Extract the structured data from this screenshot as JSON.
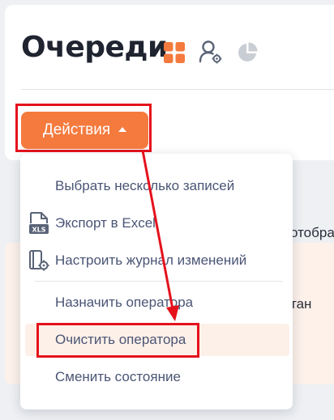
{
  "page": {
    "title": "Очереди",
    "icons": [
      "grid-icon",
      "user-gear-icon",
      "pie-chart-icon"
    ]
  },
  "actions": {
    "label": "Действия",
    "icon": "caret-up-icon"
  },
  "menu": {
    "items": [
      {
        "label": "Выбрать несколько записей",
        "icon": null
      },
      {
        "label": "Экспорт в Excel",
        "icon": "xls-file-icon"
      },
      {
        "label": "Настроить журнал изменений",
        "icon": "journal-gear-icon"
      },
      {
        "label": "Назначить оператора",
        "icon": null
      },
      {
        "label": "Очистить оператора",
        "icon": null,
        "highlighted": true
      },
      {
        "label": "Сменить состояние",
        "icon": null
      }
    ]
  },
  "background": {
    "text_1": "отобрах",
    "text_2": "тан"
  },
  "colors": {
    "accent": "#f47a3e",
    "annotation": "#e5121c",
    "highlight_bg": "#fdf0e8"
  }
}
